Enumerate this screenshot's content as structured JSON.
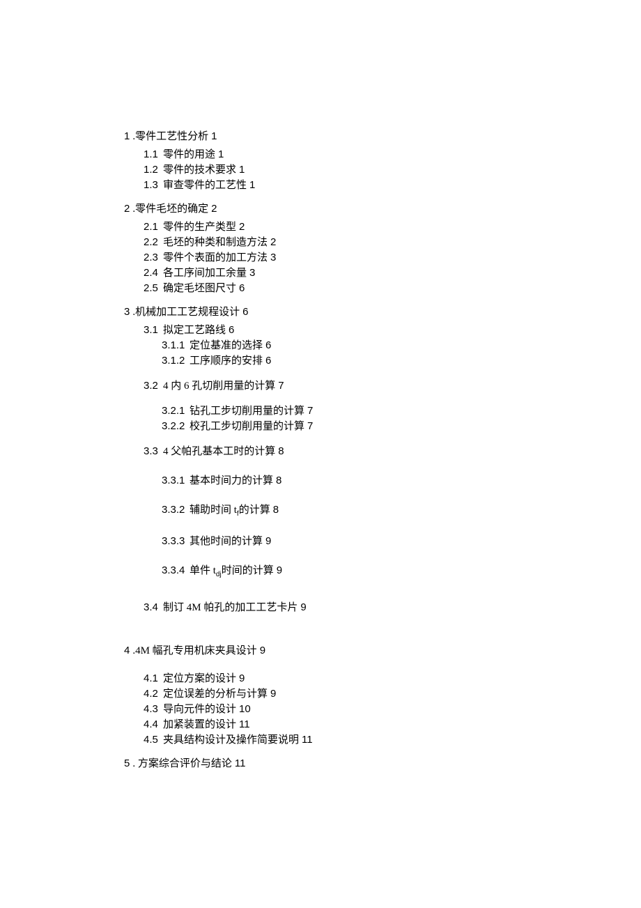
{
  "toc": {
    "s1": {
      "num": "1",
      "text": ".零件工艺性分析",
      "pg": "1"
    },
    "s1_1": {
      "num": "1.1",
      "text": "零件的用途",
      "pg": "1"
    },
    "s1_2": {
      "num": "1.2",
      "text": "零件的技术要求",
      "pg": "1"
    },
    "s1_3": {
      "num": "1.3",
      "text": "审查零件的工艺性",
      "pg": "1"
    },
    "s2": {
      "num": "2",
      "text": ".零件毛坯的确定",
      "pg": "2"
    },
    "s2_1": {
      "num": "2.1",
      "text": "零件的生产类型",
      "pg": "2"
    },
    "s2_2": {
      "num": "2.2",
      "text": "毛坯的种类和制造方法",
      "pg": "2"
    },
    "s2_3": {
      "num": "2.3",
      "text": "零件个表面的加工方法",
      "pg": "3"
    },
    "s2_4": {
      "num": "2.4",
      "text": "各工序间加工余量",
      "pg": "3"
    },
    "s2_5": {
      "num": "2.5",
      "text": "确定毛坯图尺寸",
      "pg": "6"
    },
    "s3": {
      "num": "3",
      "text": ".机械加工工艺规程设计",
      "pg": "6"
    },
    "s3_1": {
      "num": "3.1",
      "text": "拟定工艺路线",
      "pg": "6"
    },
    "s3_1_1": {
      "num": "3.1.1",
      "text": "定位基准的选择",
      "pg": "6"
    },
    "s3_1_2": {
      "num": "3.1.2",
      "text": "工序顺序的安排",
      "pg": "6"
    },
    "s3_2": {
      "num": "3.2",
      "text": "4 内 6 孔切削用量的计算",
      "pg": "7"
    },
    "s3_2_1": {
      "num": "3.2.1",
      "text": "钻孔工步切削用量的计算",
      "pg": "7"
    },
    "s3_2_2": {
      "num": "3.2.2",
      "text": "校孔工步切削用量的计算",
      "pg": "7"
    },
    "s3_3": {
      "num": "3.3",
      "text": "4 父帕孔基本工时的计算",
      "pg": "8"
    },
    "s3_3_1": {
      "num": "3.3.1",
      "text": "基本时间力的计算",
      "pg": "8"
    },
    "s3_3_2_num": "3.3.2",
    "s3_3_2_pre": "辅助时间 t",
    "s3_3_2_sub": "f",
    "s3_3_2_post": "的计算",
    "s3_3_2_pg": "8",
    "s3_3_3": {
      "num": "3.3.3",
      "text": "其他时间的计算",
      "pg": "9"
    },
    "s3_3_4_num": "3.3.4",
    "s3_3_4_pre": "单件 t",
    "s3_3_4_sub": "dj",
    "s3_3_4_post": "时间的计算",
    "s3_3_4_pg": "9",
    "s3_4": {
      "num": "3.4",
      "text": "制订 4M 帕孔的加工工艺卡片",
      "pg": "9"
    },
    "s4": {
      "num": "4",
      "text": ".4M 幅孔专用机床夹具设计",
      "pg": "9"
    },
    "s4_1": {
      "num": "4.1",
      "text": "定位方案的设计",
      "pg": "9"
    },
    "s4_2": {
      "num": "4.2",
      "text": "定位误差的分析与计算",
      "pg": "9"
    },
    "s4_3": {
      "num": "4.3",
      "text": "导向元件的设计",
      "pg": "10"
    },
    "s4_4": {
      "num": "4.4",
      "text": "加紧装置的设计",
      "pg": "11"
    },
    "s4_5": {
      "num": "4.5",
      "text": "夹具结构设计及操作简要说明",
      "pg": "11"
    },
    "s5": {
      "num": "5",
      "text": ". 方案综合评价与结论",
      "pg": "11"
    }
  }
}
